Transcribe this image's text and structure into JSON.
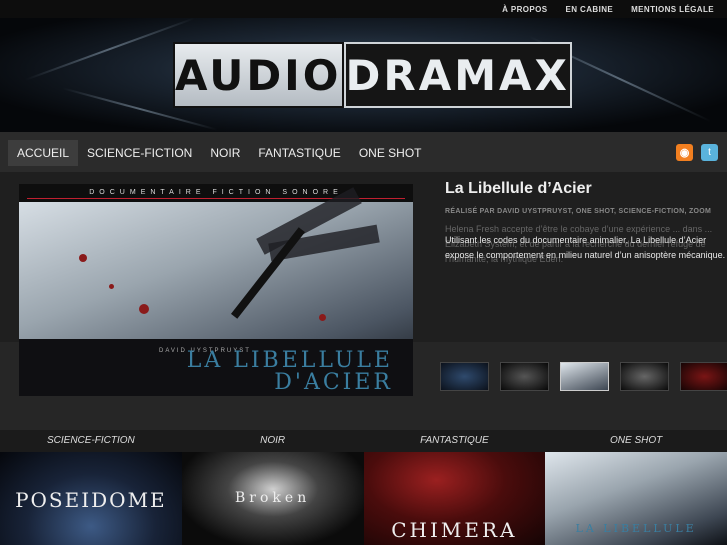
{
  "topnav": {
    "about": "À PROPOS",
    "cabin": "EN CABINE",
    "legal": "MENTIONS LÉGALE"
  },
  "logo": {
    "part1": "AUDIO",
    "part2": "DRAMAX"
  },
  "mainnav": [
    "ACCUEIL",
    "SCIENCE-FICTION",
    "NOIR",
    "FANTASTIQUE",
    "ONE  SHOT"
  ],
  "social": {
    "rss": "rss-icon",
    "twitter": "twitter-icon"
  },
  "feature": {
    "image_top": "DOCUMENTAIRE FICTION SONORE",
    "image_author": "DAVID UYSTPRUYST",
    "image_title1": "LA LIBELLULE",
    "image_title2": "D'ACIER",
    "title": "La Libellule d’Acier",
    "meta": "RÉALISÉ PAR DAVID UYSTPRUYST, ONE SHOT, SCIENCE-FICTION, ZOOM",
    "ghost_text": "Helena Fresh accepte d’être le cobaye d’une expérience ... dans ... Elizabeth System, et de partir à la recherche du dernier refuge de l’humanité, la mythique Eden.",
    "description": "Utilisant les codes du documentaire animalier, La Libellule d’Acier expose le comportement en milieu naturel d’un anisoptère mécanique."
  },
  "categories": [
    "SCIENCE-FICTION",
    "NOIR",
    "FANTASTIQUE",
    "ONE SHOT"
  ],
  "posters": [
    "POSEIDOME",
    "Broken",
    "CHIMERA",
    "LA LIBELLULE"
  ]
}
